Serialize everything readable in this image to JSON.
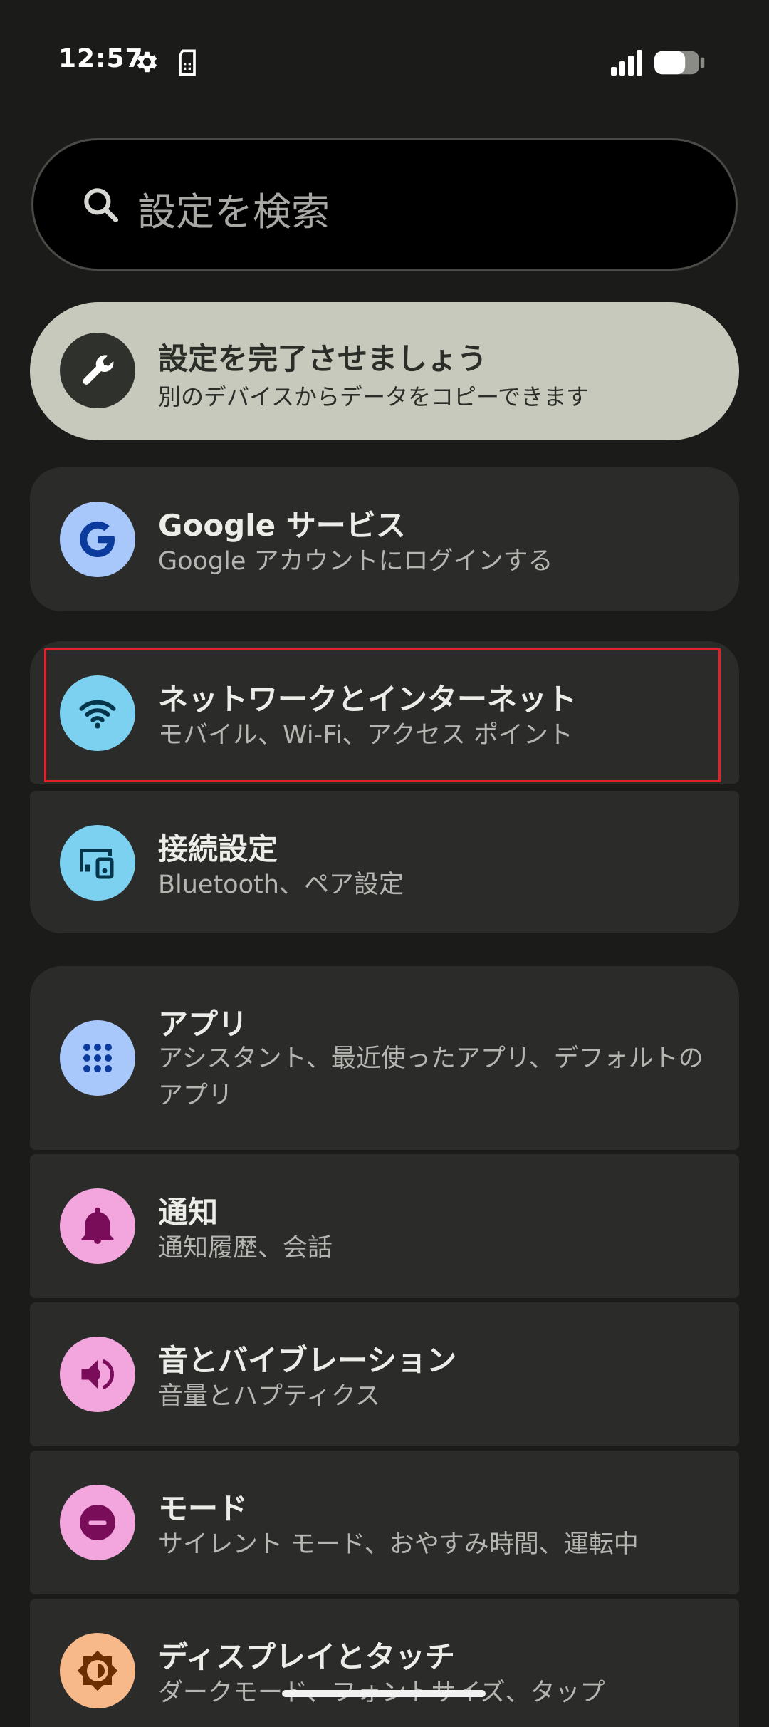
{
  "status_bar": {
    "time": "12:57",
    "icons": [
      "gear-icon",
      "sim-icon",
      "signal-icon",
      "battery-icon"
    ]
  },
  "search": {
    "placeholder": "設定を検索"
  },
  "setup_banner": {
    "title": "設定を完了させましょう",
    "subtitle": "別のデバイスからデータをコピーできます"
  },
  "items": [
    {
      "title": "Google サービス",
      "subtitle": "Google アカウントにログインする",
      "icon": "google-icon",
      "icon_bg": "#a8c7fa"
    },
    {
      "title": "ネットワークとインターネット",
      "subtitle": "モバイル、Wi-Fi、アクセス ポイント",
      "icon": "wifi-icon",
      "icon_bg": "#7cd0f0"
    },
    {
      "title": "接続設定",
      "subtitle": "Bluetooth、ペア設定",
      "icon": "devices-icon",
      "icon_bg": "#7cd0f0"
    },
    {
      "title": "アプリ",
      "subtitle": "アシスタント、最近使ったアプリ、デフォルトのアプリ",
      "icon": "apps-grid-icon",
      "icon_bg": "#a8c7fa"
    },
    {
      "title": "通知",
      "subtitle": "通知履歴、会話",
      "icon": "bell-icon",
      "icon_bg": "#f3a6dd"
    },
    {
      "title": "音とバイブレーション",
      "subtitle": "音量とハプティクス",
      "icon": "speaker-icon",
      "icon_bg": "#f3a6dd"
    },
    {
      "title": "モード",
      "subtitle": "サイレント モード、おやすみ時間、運転中",
      "icon": "dnd-icon",
      "icon_bg": "#f3a6dd"
    },
    {
      "title": "ディスプレイとタッチ",
      "subtitle": "ダークモード、フォントサイズ、タップ",
      "icon": "brightness-icon",
      "icon_bg": "#f7b88a"
    }
  ]
}
